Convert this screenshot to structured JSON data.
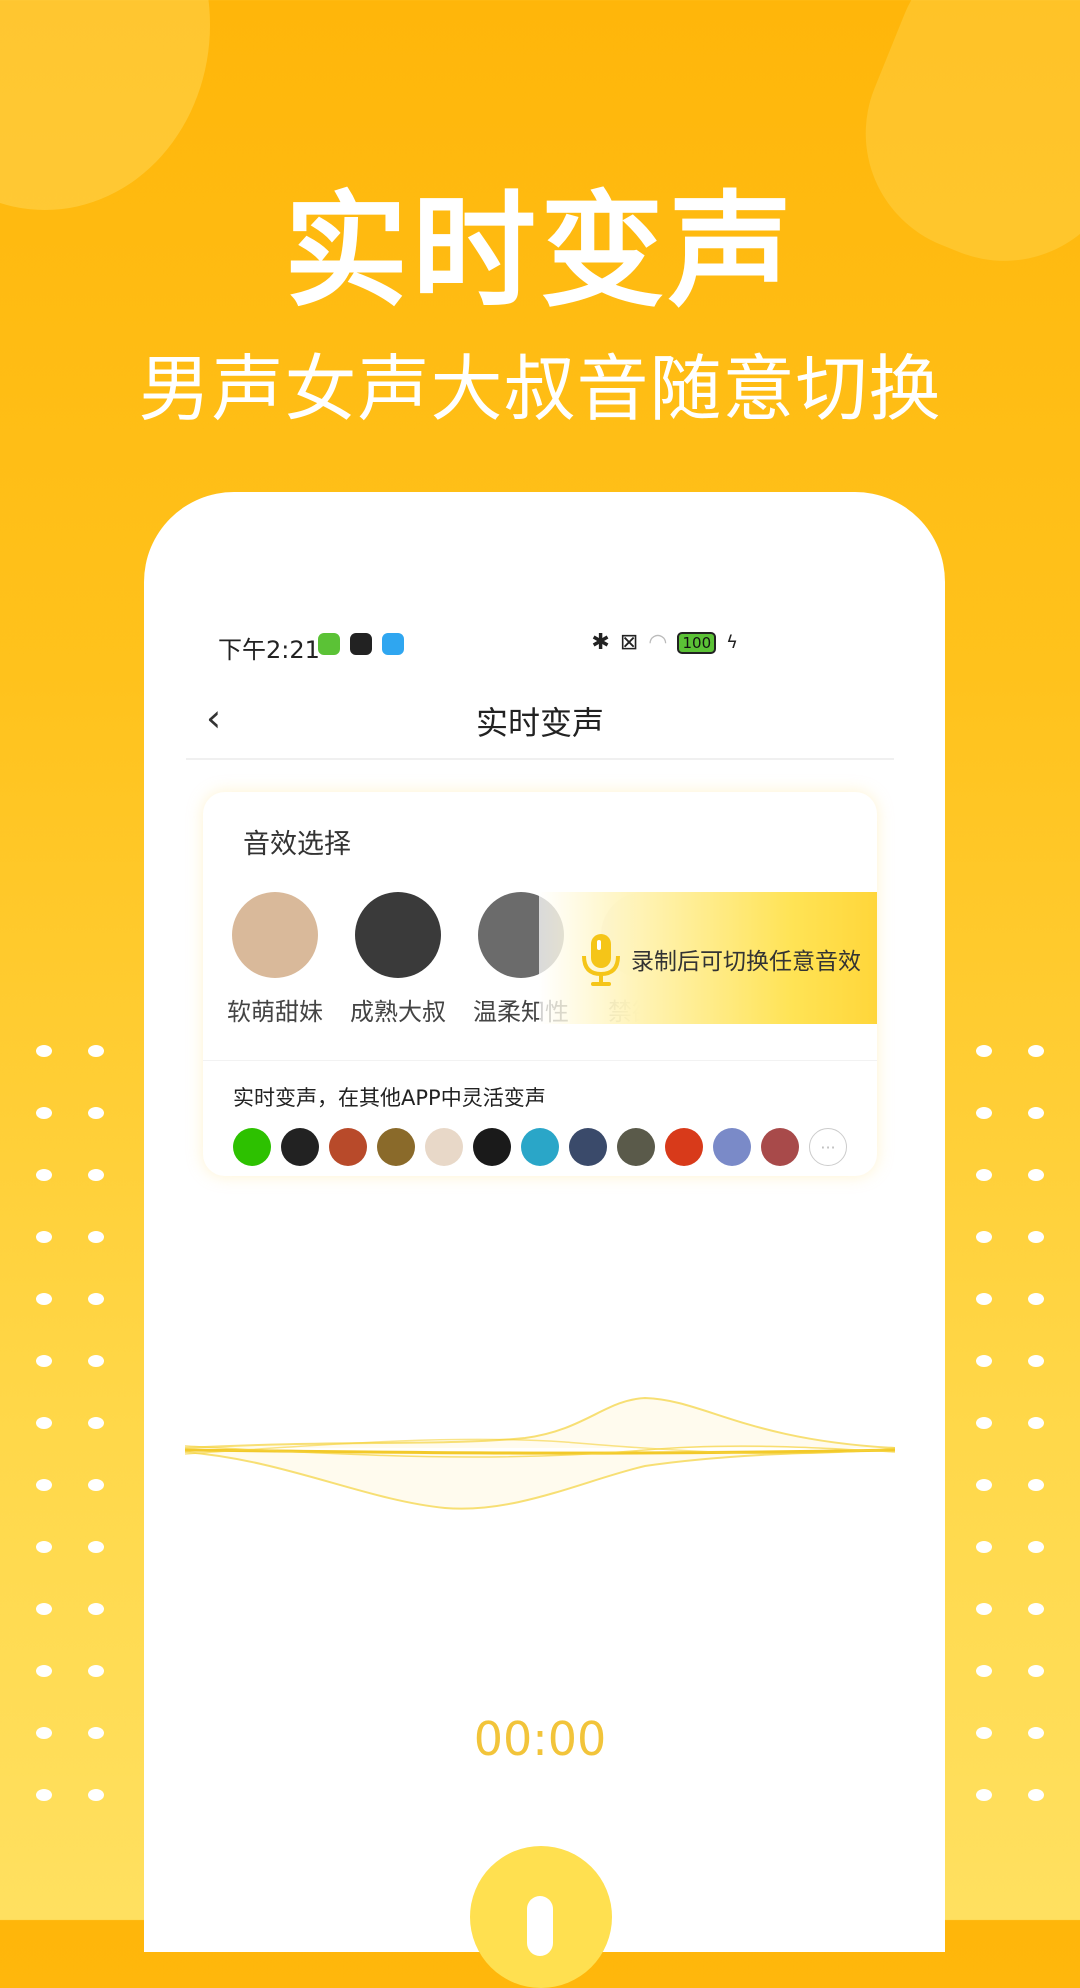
{
  "hero": {
    "title": "实时变声",
    "subtitle": "男声女声大叔音随意切换"
  },
  "status_bar": {
    "time": "下午2:21",
    "notification_icons": [
      "app-green-icon",
      "app-dark-icon",
      "app-blue-icon"
    ],
    "system_icons": [
      "bluetooth-icon",
      "no-sim-icon",
      "wifi-icon",
      "battery-icon",
      "charging-icon"
    ],
    "battery": "100"
  },
  "nav": {
    "back_icon": "chevron-left-icon",
    "title": "实时变声"
  },
  "effects_card": {
    "title": "音效选择",
    "voices": [
      {
        "label": "软萌甜妹",
        "color": "#d9b99a"
      },
      {
        "label": "成熟大叔",
        "color": "#3a3a3a"
      },
      {
        "label": "温柔知性",
        "color": "#6b6b6b"
      },
      {
        "label": "禁欲系",
        "color": "#e8e0d0"
      },
      {
        "label": "",
        "color": "#efe6c8"
      }
    ],
    "overlay_text": "录制后可切换任意音效",
    "overlay_icon": "microphone-icon"
  },
  "apps_section": {
    "label": "实时变声，在其他APP中灵活变声",
    "apps": [
      {
        "name": "wechat",
        "color": "#2DC100"
      },
      {
        "name": "qq",
        "color": "#222222"
      },
      {
        "name": "honor-of-kings",
        "color": "#b84a2a"
      },
      {
        "name": "pubg",
        "color": "#8a6a2a"
      },
      {
        "name": "genshin",
        "color": "#e8d8c8"
      },
      {
        "name": "soul",
        "color": "#1a1a1a"
      },
      {
        "name": "game-7",
        "color": "#2aa6c8"
      },
      {
        "name": "game-8",
        "color": "#3a4a6a"
      },
      {
        "name": "game-9",
        "color": "#5a5a4a"
      },
      {
        "name": "game-10",
        "color": "#d83a1a"
      },
      {
        "name": "game-11",
        "color": "#7a8ac8"
      },
      {
        "name": "game-12",
        "color": "#a84a4a"
      }
    ],
    "more_label": "···"
  },
  "recorder": {
    "timer": "00:00",
    "record_icon": "microphone-icon"
  },
  "colors": {
    "accent": "#FFC21C",
    "timer": "#F2C43A",
    "button": "#FFE050"
  }
}
